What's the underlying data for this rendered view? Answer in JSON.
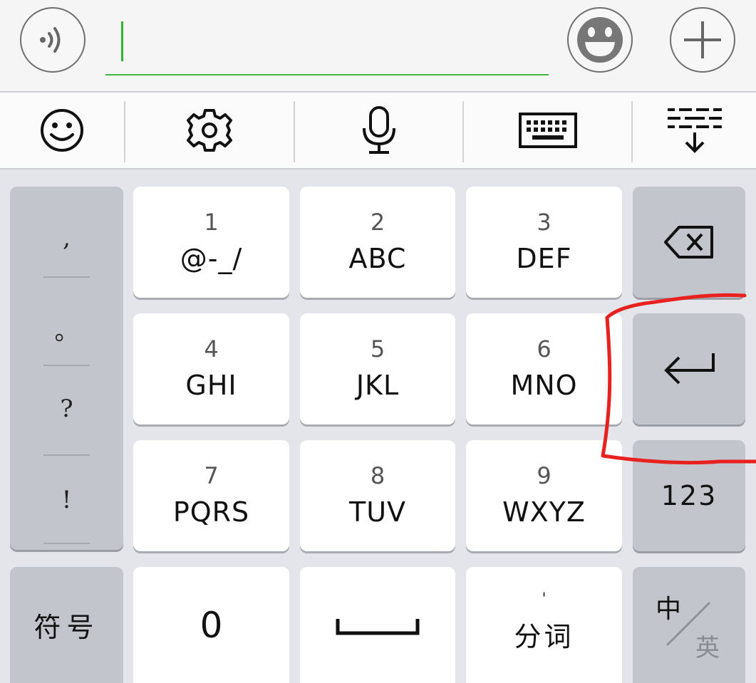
{
  "input_bar": {
    "voice_icon": "voice-wave-icon",
    "emoji_icon": "grinning-face-icon",
    "plus_icon": "plus-icon",
    "text_value": ""
  },
  "toolbar": {
    "items": [
      {
        "name": "toolbar-emoji",
        "icon": "smiley-icon"
      },
      {
        "name": "toolbar-settings",
        "icon": "gear-icon"
      },
      {
        "name": "toolbar-voice",
        "icon": "microphone-icon"
      },
      {
        "name": "toolbar-keyboard",
        "icon": "keyboard-icon"
      },
      {
        "name": "toolbar-collapse",
        "icon": "collapse-keyboard-icon"
      }
    ]
  },
  "keyboard": {
    "punctuation": [
      ",",
      "。",
      "?",
      "!"
    ],
    "keys": [
      {
        "num": "1",
        "letters": "@-_/"
      },
      {
        "num": "2",
        "letters": "ABC"
      },
      {
        "num": "3",
        "letters": "DEF"
      },
      {
        "num": "4",
        "letters": "GHI"
      },
      {
        "num": "5",
        "letters": "JKL"
      },
      {
        "num": "6",
        "letters": "MNO"
      },
      {
        "num": "7",
        "letters": "PQRS"
      },
      {
        "num": "8",
        "letters": "TUV"
      },
      {
        "num": "9",
        "letters": "WXYZ"
      }
    ],
    "backspace_icon": "backspace-icon",
    "enter_icon": "enter-arrow-icon",
    "numbers_label": "123",
    "symbols_label": "符号",
    "zero_label": "0",
    "space_icon": "space-bar-icon",
    "separator_mark": "'",
    "segment_label": "分词",
    "lang_cn": "中",
    "lang_en": "英"
  },
  "colors": {
    "accent_green": "#2fb52f",
    "annotation_red": "#e8201e"
  }
}
